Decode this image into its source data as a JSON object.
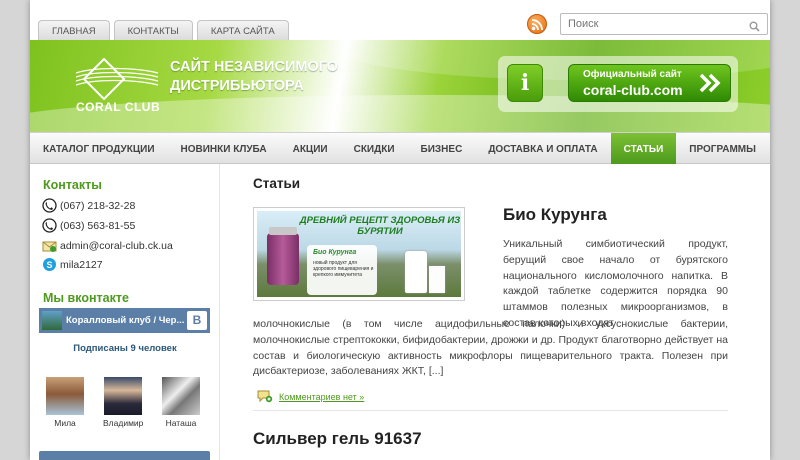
{
  "top_tabs": [
    "ГЛАВНАЯ",
    "КОНТАКТЫ",
    "КАРТА САЙТА"
  ],
  "search": {
    "placeholder": "Поиск"
  },
  "banner": {
    "logo_text": "CORAL CLUB",
    "site_title": [
      "САЙТ НЕЗАВИСИМОГО",
      "ДИСТРИБЬЮТОРА"
    ],
    "info_label": "i",
    "official_line1": "Официальный сайт",
    "official_line2": "coral-club.com"
  },
  "nav": {
    "items": [
      "КАТАЛОГ ПРОДУКЦИИ",
      "НОВИНКИ КЛУБА",
      "АКЦИИ",
      "СКИДКИ",
      "БИЗНЕС",
      "ДОСТАВКА И ОПЛАТА",
      "СТАТЬИ",
      "ПРОГРАММЫ"
    ],
    "active": "СТАТЬИ"
  },
  "sidebar": {
    "contacts_title": "Контакты",
    "phone1": "(067) 218-32-28",
    "phone2": "(063) 563-81-55",
    "email": "admin@coral-club.ck.ua",
    "skype": "mila2127",
    "vk_title": "Мы вконтакте",
    "vk_group": "Коралловый клуб / Чер...",
    "vk_button": "B",
    "subscribers": "Подписаны 9 человек",
    "friends": [
      "Мила",
      "Владимир",
      "Наташа"
    ]
  },
  "content": {
    "page_title": "Статьи",
    "article1": {
      "title": "Био Курунга",
      "image_caption": "ДРЕВНИЙ РЕЦЕПТ ЗДОРОВЬЯ ИЗ БУРЯТИИ",
      "image_card_title": "Био Курунга",
      "image_card_text": "новый продукт для здорового пищеварения и крепкого иммунитета",
      "text_part1": "Уникальный симбиотический продукт, берущий свое начало от бурятского национального кисломолочного напитка. В каждой таблетке содержится порядка 90 штаммов полезных микроорганизмов, в состав которых входят",
      "text_part2": "молочнокислые (в том числе ацидофильные палочки) и уксуснокислые бактерии, молочнокислые стрептококки, бифидобактерии, дрожжи и др. Продукт благотворно действует на состав и биологическую активность микрофлоры пищеварительного тракта. Полезен при дисбактериозе, заболеваниях ЖКТ, [...]",
      "comments": "Комментариев нет »"
    },
    "article2": {
      "title": "Сильвер гель 91637"
    }
  },
  "colors": {
    "accent_green": "#4e9a1d",
    "vk_blue": "#5b7fa6",
    "rss_orange": "#e26a10"
  }
}
